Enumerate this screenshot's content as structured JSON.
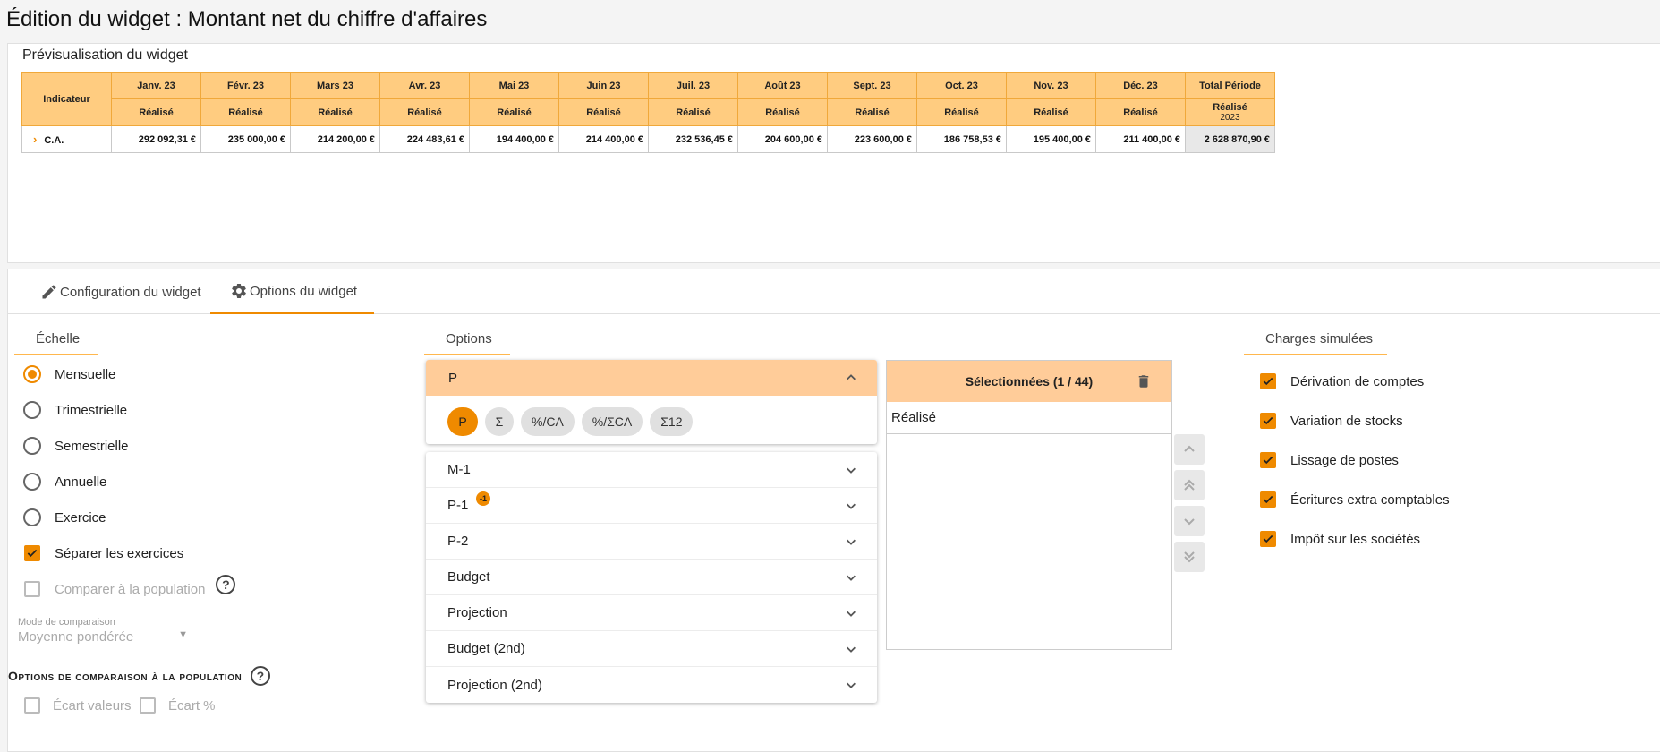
{
  "page_title": "Édition du widget : Montant net du chiffre d'affaires",
  "preview": {
    "title": "Prévisualisation du widget",
    "indicator_header": "Indicateur",
    "months": [
      "Janv. 23",
      "Févr. 23",
      "Mars 23",
      "Avr. 23",
      "Mai 23",
      "Juin 23",
      "Juil. 23",
      "Août 23",
      "Sept. 23",
      "Oct. 23",
      "Nov. 23",
      "Déc. 23"
    ],
    "total_header": "Total Période",
    "sub_label": "Réalisé",
    "total_sub_year": "2023",
    "row": {
      "label": "C.A.",
      "values": [
        "292 092,31 €",
        "235 000,00 €",
        "214 200,00 €",
        "224 483,61 €",
        "194 400,00 €",
        "214 400,00 €",
        "232 536,45 €",
        "204 600,00 €",
        "223 600,00 €",
        "186 758,53 €",
        "195 400,00 €",
        "211 400,00 €"
      ],
      "total": "2 628 870,90 €"
    }
  },
  "tabs": {
    "config": "Configuration du widget",
    "options": "Options du widget"
  },
  "echelle": {
    "title": "Échelle",
    "radios": [
      {
        "label": "Mensuelle",
        "checked": true
      },
      {
        "label": "Trimestrielle",
        "checked": false
      },
      {
        "label": "Semestrielle",
        "checked": false
      },
      {
        "label": "Annuelle",
        "checked": false
      },
      {
        "label": "Exercice",
        "checked": false
      }
    ],
    "separer": "Séparer les exercices",
    "comparer": "Comparer à la population",
    "mode_label": "Mode de comparaison",
    "mode_value": "Moyenne pondérée"
  },
  "population": {
    "title": "Options de comparaison à la population",
    "ecart_valeurs": "Écart valeurs",
    "ecart_pct": "Écart %"
  },
  "options": {
    "title": "Options",
    "p_label": "P",
    "chips": [
      "P",
      "Σ",
      "%/CA",
      "%/ΣCA",
      "Σ12"
    ],
    "accordion": [
      "M-1",
      "P-1",
      "P-2",
      "Budget",
      "Projection",
      "Budget (2nd)",
      "Projection (2nd)"
    ],
    "p1_badge": "-1"
  },
  "selected": {
    "title": "Sélectionnées (1 / 44)",
    "items": [
      "Réalisé"
    ]
  },
  "charges": {
    "title": "Charges simulées",
    "items": [
      "Dérivation de comptes",
      "Variation de stocks",
      "Lissage de postes",
      "Écritures extra comptables",
      "Impôt sur les sociétés"
    ]
  },
  "colors": {
    "accent": "#ef8a00",
    "header_fill": "#ffcc80",
    "panel_head": "#ffcc99"
  }
}
